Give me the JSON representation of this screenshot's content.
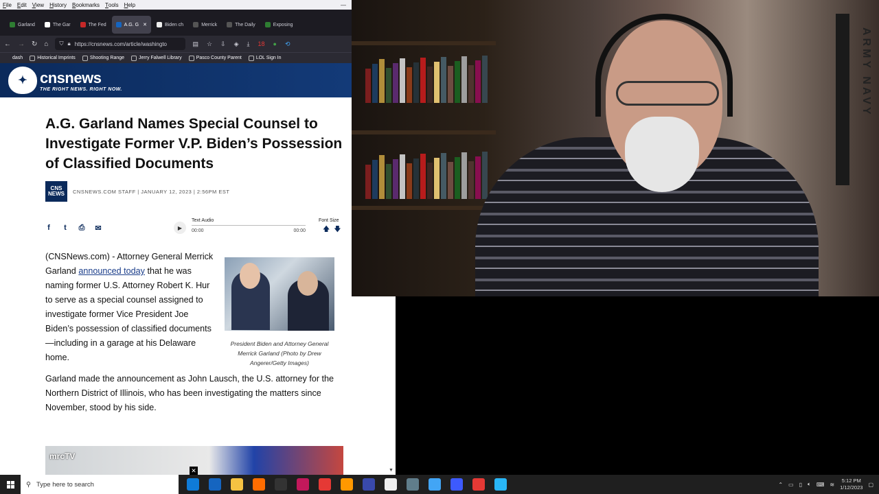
{
  "menubar": {
    "items": [
      {
        "label": "File",
        "accel": "F",
        "rest": "ile"
      },
      {
        "label": "Edit",
        "accel": "E",
        "rest": "dit"
      },
      {
        "label": "View",
        "accel": "V",
        "rest": "iew"
      },
      {
        "label": "History",
        "accel": "H",
        "rest": "istory"
      },
      {
        "label": "Bookmarks",
        "accel": "B",
        "rest": "ookmarks"
      },
      {
        "label": "Tools",
        "accel": "T",
        "rest": "ools"
      },
      {
        "label": "Help",
        "accel": "H",
        "rest": "elp"
      }
    ],
    "window_control": "—"
  },
  "tabs": [
    {
      "label": "Garland",
      "color": "#2e7d32"
    },
    {
      "label": "The Gar",
      "color": "#ffffff"
    },
    {
      "label": "The Fed",
      "color": "#c62828"
    },
    {
      "label": "A.G. G",
      "color": "#1565c0",
      "close": "✕"
    },
    {
      "label": "Biden ch",
      "color": "#eeeeee"
    },
    {
      "label": "Merrick",
      "color": "#555555"
    },
    {
      "label": "The Daily",
      "color": "#555555"
    },
    {
      "label": "Exposing",
      "color": "#2e7d32"
    }
  ],
  "nav": {
    "back": "←",
    "forward": "→",
    "reload": "↻",
    "home": "⌂",
    "url": "https://cnsnews.com/article/washingto",
    "ext_badge": "18"
  },
  "bookmarks": [
    {
      "label": "dash"
    },
    {
      "label": "Historical Imprints"
    },
    {
      "label": "Shooting Range"
    },
    {
      "label": "Jerry Falwell Library"
    },
    {
      "label": "Pasco County Parent"
    },
    {
      "label": "LOL Sign In"
    }
  ],
  "site": {
    "brand": "cnsnews",
    "tagline": "THE RIGHT NEWS. RIGHT NOW."
  },
  "article": {
    "headline": "A.G. Garland Names Special Counsel to Investigate Former V.P. Biden’s Possession of Classified Documents",
    "byline_logo": "CNS NEWS",
    "byline": "CNSNEWS.COM STAFF | JANUARY 12, 2023 | 2:56PM EST",
    "share_icons": [
      "f",
      "t",
      "⎙",
      "✉"
    ],
    "audio": {
      "label": "Text Audio",
      "start": "00:00",
      "end": "00:00",
      "play": "▶"
    },
    "font_size": {
      "label": "Font Size",
      "up": "🡅",
      "down": "🡇"
    },
    "para1_a": "(CNSNews.com) - Attorney General Merrick Garland ",
    "para1_link": "announced today",
    "para1_b": " that he was naming former U.S. Attorney Robert K. Hur to serve as a special counsel assigned to investigate former Vice President Joe Biden’s possession of classified documents—including in a garage at his Delaware home.",
    "caption": "President Biden and Attorney General Merrick Garland (Photo by Drew Angerer/Getty Images)",
    "para2": "Garland made the announcement as John Lausch, the U.S. attorney for the Northern District of Illinois, who has been investigating the matters since November, stood by his side.",
    "video_logo": "mrcTV",
    "video_close": "✕"
  },
  "webcam": {
    "flag_text": "ARMY NAVY"
  },
  "taskbar": {
    "search_placeholder": "Type here to search",
    "time": "5:12 PM",
    "date": "1/12/2023",
    "apps": [
      {
        "name": "edge",
        "color": "#0f7bd8"
      },
      {
        "name": "mail",
        "color": "#1565c0"
      },
      {
        "name": "explorer",
        "color": "#f5c242"
      },
      {
        "name": "firefox",
        "color": "#ff6d00"
      },
      {
        "name": "terminal",
        "color": "#333333"
      },
      {
        "name": "app6",
        "color": "#c2185b"
      },
      {
        "name": "app7",
        "color": "#e53935"
      },
      {
        "name": "app8",
        "color": "#ff9800"
      },
      {
        "name": "app9",
        "color": "#3949ab"
      },
      {
        "name": "app10",
        "color": "#eeeeee"
      },
      {
        "name": "calculator",
        "color": "#607d8b"
      },
      {
        "name": "app12",
        "color": "#42a5f5"
      },
      {
        "name": "headset",
        "color": "#3d5afe"
      },
      {
        "name": "obs",
        "color": "#e53935"
      },
      {
        "name": "app15",
        "color": "#29b6f6"
      }
    ]
  }
}
